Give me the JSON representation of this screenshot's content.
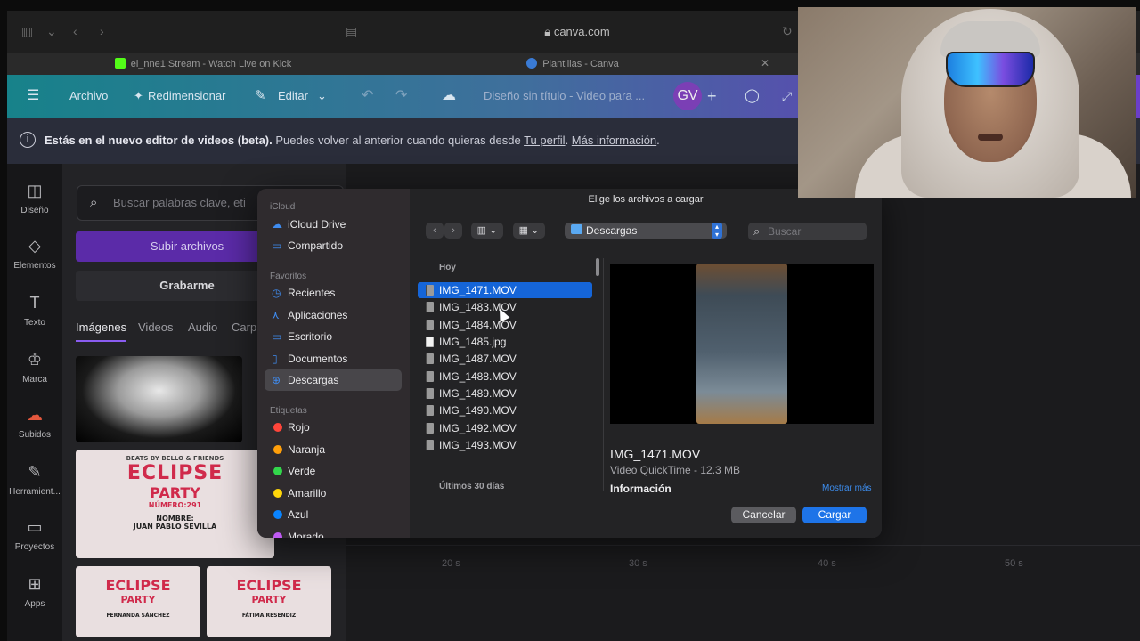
{
  "browser": {
    "url": "canva.com",
    "tabs": [
      {
        "label": "el_nne1 Stream - Watch Live on Kick",
        "favicon_color": "#53fc18"
      },
      {
        "label": "Plantillas - Canva",
        "favicon_color": "#3a7bd5"
      }
    ]
  },
  "canva": {
    "menu": {
      "file": "Archivo",
      "resize": "Redimensionar",
      "edit": "Editar",
      "doc_title": "Diseño sin título - Video para ...",
      "avatar_initials": "GV"
    },
    "banner": {
      "bold": "Estás en el nuevo editor de videos (beta).",
      "text": " Puedes volver al anterior cuando quieras desde ",
      "link1": "Tu perfil",
      "sep": ". ",
      "link2": "Más información",
      "end": "."
    },
    "rail": [
      {
        "label": "Diseño",
        "icon": "layout-icon"
      },
      {
        "label": "Elementos",
        "icon": "shapes-icon"
      },
      {
        "label": "Texto",
        "icon": "text-icon"
      },
      {
        "label": "Marca",
        "icon": "brand-icon"
      },
      {
        "label": "Subidos",
        "icon": "upload-cloud-icon"
      },
      {
        "label": "Herramient...",
        "icon": "tools-icon"
      },
      {
        "label": "Proyectos",
        "icon": "folder-icon"
      },
      {
        "label": "Apps",
        "icon": "apps-icon"
      }
    ],
    "panel": {
      "search_placeholder": "Buscar palabras clave, eti",
      "upload_button": "Subir archivos",
      "record_button": "Grabarme",
      "media_tabs": [
        "Imágenes",
        "Videos",
        "Audio",
        "Carp"
      ],
      "poster1_title": "ECLIPSE",
      "poster1_sub": "PARTY",
      "poster1_num": "NÚMERO:291",
      "poster1_name_label": "NOMBRE:",
      "poster1_name": "JUAN PABLO SEVILLA",
      "poster1_header": "BEATS BY BELLO & FRIENDS",
      "poster2_title": "ECLIPSE",
      "poster2_sub": "PARTY",
      "poster2_name": "FERNANDA SÁNCHEZ",
      "poster3_title": "ECLIPSE",
      "poster3_sub": "PARTY",
      "poster3_name": "FÁTIMA RESENDIZ"
    },
    "timeline": [
      "20 s",
      "30 s",
      "40 s",
      "50 s"
    ]
  },
  "dialog": {
    "title": "Elige los archivos a cargar",
    "sidebar": {
      "icloud_header": "iCloud",
      "icloud": [
        {
          "label": "iCloud Drive",
          "icon": "cloud-icon"
        },
        {
          "label": "Compartido",
          "icon": "shared-folder-icon"
        }
      ],
      "favorites_header": "Favoritos",
      "favorites": [
        {
          "label": "Recientes",
          "icon": "clock-icon"
        },
        {
          "label": "Aplicaciones",
          "icon": "apps-icon"
        },
        {
          "label": "Escritorio",
          "icon": "desktop-icon"
        },
        {
          "label": "Documentos",
          "icon": "document-icon"
        },
        {
          "label": "Descargas",
          "icon": "download-icon"
        }
      ],
      "tags_header": "Etiquetas",
      "tags": [
        {
          "label": "Rojo",
          "color": "#ff453a"
        },
        {
          "label": "Naranja",
          "color": "#ff9f0a"
        },
        {
          "label": "Verde",
          "color": "#32d74b"
        },
        {
          "label": "Amarillo",
          "color": "#ffd60a"
        },
        {
          "label": "Azul",
          "color": "#0a84ff"
        },
        {
          "label": "Morado",
          "color": "#bf5af2"
        }
      ]
    },
    "location": "Descargas",
    "search_placeholder": "Buscar",
    "group_today": "Hoy",
    "files": [
      {
        "name": "IMG_1471.MOV",
        "type": "mov",
        "selected": true
      },
      {
        "name": "IMG_1483.MOV",
        "type": "mov"
      },
      {
        "name": "IMG_1484.MOV",
        "type": "mov"
      },
      {
        "name": "IMG_1485.jpg",
        "type": "jpg"
      },
      {
        "name": "IMG_1487.MOV",
        "type": "mov"
      },
      {
        "name": "IMG_1488.MOV",
        "type": "mov"
      },
      {
        "name": "IMG_1489.MOV",
        "type": "mov"
      },
      {
        "name": "IMG_1490.MOV",
        "type": "mov"
      },
      {
        "name": "IMG_1492.MOV",
        "type": "mov"
      },
      {
        "name": "IMG_1493.MOV",
        "type": "mov"
      }
    ],
    "group_last30": "Últimos 30 días",
    "preview": {
      "filename": "IMG_1471.MOV",
      "kind": "Video QuickTime - 12.3 MB",
      "info_label": "Información",
      "show_more": "Mostrar más"
    },
    "cancel": "Cancelar",
    "confirm": "Cargar"
  }
}
